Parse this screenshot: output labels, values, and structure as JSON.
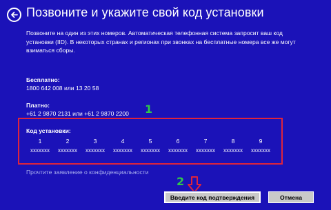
{
  "header": {
    "back_icon": "back-arrow-icon",
    "title": "Позвоните и укажите свой код установки"
  },
  "intro": "Позвоните на один из этих номеров. Автоматическая телефонная система запросит ваш код установки (IID). В некоторых странах и регионах при звонках на бесплатные номера все же могут взиматься сборы.",
  "free": {
    "label": "Бесплатно:",
    "numbers": "1800 642 008 или 13 20 58"
  },
  "paid": {
    "label": "Платно:",
    "numbers": "+61 2 9870 2131 или +61 2 9870 2200"
  },
  "install_id": {
    "label": "Код установки:",
    "groups": [
      {
        "num": "1",
        "value": "xxxxxxx"
      },
      {
        "num": "2",
        "value": "xxxxxxx"
      },
      {
        "num": "3",
        "value": "xxxxxxx"
      },
      {
        "num": "4",
        "value": "xxxxxxx"
      },
      {
        "num": "5",
        "value": "xxxxxxx"
      },
      {
        "num": "6",
        "value": "xxxxxxx"
      },
      {
        "num": "7",
        "value": "xxxxxxx"
      },
      {
        "num": "8",
        "value": "xxxxxxx"
      },
      {
        "num": "9",
        "value": "xxxxxxx"
      }
    ]
  },
  "privacy_link": "Прочтите заявление о конфиденциальности",
  "annotations": {
    "marker_1": "1",
    "marker_2": "2",
    "arrow_icon": "red-down-arrow-icon",
    "highlight_color": "#e0243b",
    "marker_color": "#2fc94a"
  },
  "buttons": {
    "confirm": "Введите код подтверждения",
    "cancel": "Отмена"
  },
  "colors": {
    "background": "#1b12b8",
    "button": "#c9c9c9"
  }
}
